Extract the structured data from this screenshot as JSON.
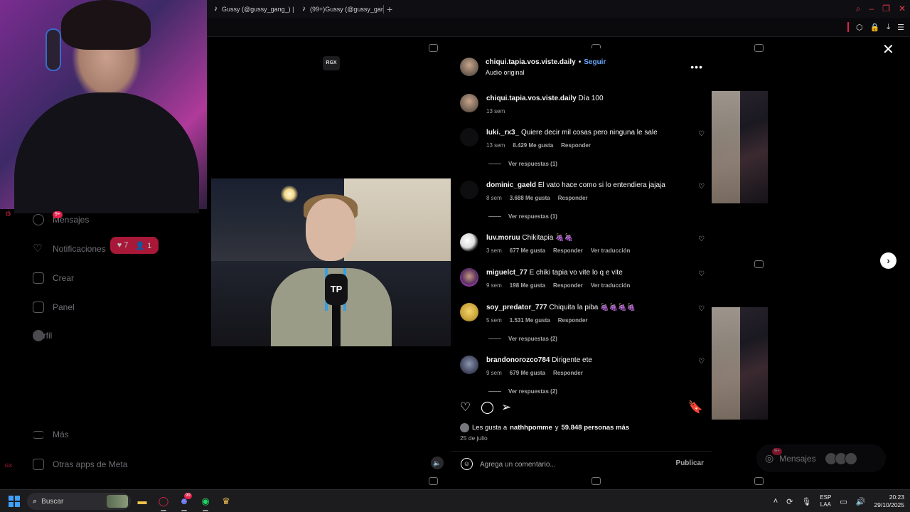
{
  "browser": {
    "tabs": [
      {
        "title": "Gussy (@gussy_gang_) |"
      },
      {
        "title": "(99+)Gussy (@gussy_gan"
      }
    ],
    "new_tab_symbol": "+"
  },
  "sidebar": {
    "items": [
      {
        "label": "Mensajes",
        "icon": "messenger-icon",
        "badge": "9+"
      },
      {
        "label": "Notificaciones",
        "icon": "heart-icon"
      },
      {
        "label": "Crear",
        "icon": "plus-square-icon"
      },
      {
        "label": "Panel",
        "icon": "chart-icon"
      },
      {
        "label": "Perfil",
        "icon": "avatar-icon"
      },
      {
        "label": "Más",
        "icon": "menu-icon"
      },
      {
        "label": "Otras apps de Meta",
        "icon": "meta-apps-icon"
      }
    ],
    "notif_pill": {
      "likes": "7",
      "follows": "1"
    },
    "gx_label": "GX"
  },
  "video": {
    "watermark": "RGX",
    "mic_logo": "TP"
  },
  "post": {
    "header": {
      "username": "chiqui.tapia.vos.viste.daily",
      "follow_label": "Seguir",
      "audio": "Audio original"
    },
    "caption": {
      "username": "chiqui.tapia.vos.viste.daily",
      "text": "Día 100",
      "time": "13 sem"
    },
    "comments": [
      {
        "user": "luki._rx3_",
        "text": "Quiere decir mil cosas pero ninguna le sale",
        "time": "13 sem",
        "likes": "8.429 Me gusta",
        "reply": "Responder",
        "translate": "",
        "replies": "Ver respuestas (1)"
      },
      {
        "user": "dominic_gaeld",
        "text": "El vato hace como si lo entendiera jajaja",
        "time": "8 sem",
        "likes": "3.688 Me gusta",
        "reply": "Responder",
        "translate": "",
        "replies": "Ver respuestas (1)"
      },
      {
        "user": "luv.moruu",
        "text": "Chikitapia 🍇🍇",
        "time": "3 sem",
        "likes": "677 Me gusta",
        "reply": "Responder",
        "translate": "Ver traducción",
        "replies": ""
      },
      {
        "user": "miguelct_77",
        "text": "E chiki tapia vo vite lo q e vite",
        "time": "9 sem",
        "likes": "198 Me gusta",
        "reply": "Responder",
        "translate": "Ver traducción",
        "replies": ""
      },
      {
        "user": "soy_predator_777",
        "text": "Chiquita la piba 🍇🍇🍇🍇",
        "time": "5 sem",
        "likes": "1.531 Me gusta",
        "reply": "Responder",
        "translate": "",
        "replies": "Ver respuestas (2)"
      },
      {
        "user": "brandonorozco784",
        "text": "Dirigente ete",
        "time": "9 sem",
        "likes": "679 Me gusta",
        "reply": "Responder",
        "translate": "",
        "replies": "Ver respuestas (2)"
      }
    ],
    "likes_prefix": "Les gusta a",
    "likes_user": "nathhpomme",
    "likes_mid": "y",
    "likes_count": "59.848 personas más",
    "date": "25 de julio",
    "comment_placeholder": "Agrega un comentario...",
    "publish_label": "Publicar"
  },
  "floating_messages": {
    "label": "Mensajes",
    "badge": "9+"
  },
  "taskbar": {
    "search_label": "Buscar",
    "discord_badge": "99",
    "lang_top": "ESP",
    "lang_bottom": "LAA",
    "time": "20:23",
    "date": "29/10/2025"
  },
  "colors": {
    "accent_blue": "#6aa8ff",
    "opera_red": "#e0214b",
    "panel_bg": "#000000"
  }
}
